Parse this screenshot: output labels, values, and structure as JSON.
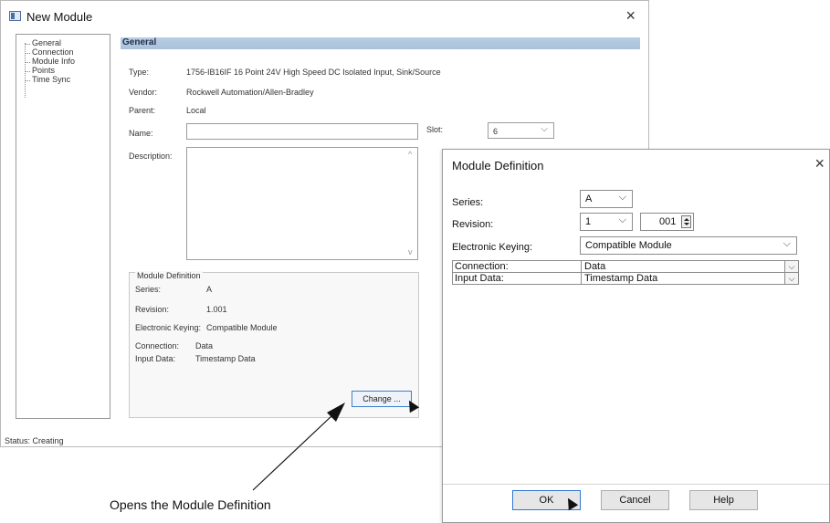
{
  "new_module": {
    "title": "New Module",
    "close": "×",
    "tree": [
      "General",
      "Connection",
      "Module Info",
      "Points",
      "Time Sync"
    ],
    "section_header": "General",
    "type_label": "Type:",
    "type_value": "1756-IB16IF 16 Point 24V High Speed DC Isolated Input, Sink/Source",
    "vendor_label": "Vendor:",
    "vendor_value": "Rockwell Automation/Allen-Bradley",
    "parent_label": "Parent:",
    "parent_value": "Local",
    "name_label": "Name:",
    "name_value": "",
    "slot_label": "Slot:",
    "slot_value": "6",
    "description_label": "Description:",
    "description_value": "",
    "module_definition": {
      "legend": "Module Definition",
      "series_label": "Series:",
      "series_value": "A",
      "revision_label": "Revision:",
      "revision_value": "1.001",
      "keying_label": "Electronic Keying:",
      "keying_value": "Compatible Module",
      "connection_label": "Connection:",
      "connection_value": "Data",
      "input_data_label": "Input Data:",
      "input_data_value": "Timestamp Data"
    },
    "change_button": "Change ...",
    "status": "Status: Creating"
  },
  "module_definition_dialog": {
    "title": "Module Definition",
    "close": "×",
    "series_label": "Series:",
    "series_value": "A",
    "revision_label": "Revision:",
    "revision_major": "1",
    "revision_minor": "001",
    "keying_label": "Electronic Keying:",
    "keying_value": "Compatible Module",
    "rows": [
      {
        "label": "Connection:",
        "value": "Data"
      },
      {
        "label": "Input Data:",
        "value": "Timestamp Data"
      }
    ],
    "ok": "OK",
    "cancel": "Cancel",
    "help": "Help"
  },
  "caption": "Opens the Module Definition"
}
